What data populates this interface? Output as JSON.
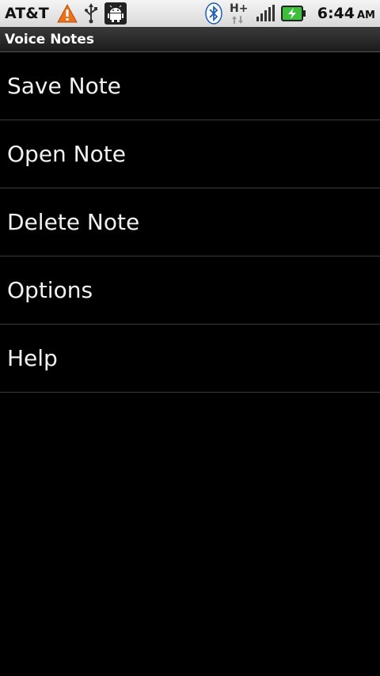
{
  "status_bar": {
    "carrier": "AT&T",
    "time": "6:44",
    "ampm": "AM",
    "network": "H+",
    "icons": [
      "warning-icon",
      "usb-icon",
      "android-debug-icon",
      "bluetooth-icon",
      "network-hplus-icon",
      "signal-icon",
      "battery-charging-icon"
    ],
    "colors": {
      "warning": "#e8731c",
      "battery": "#3cc03c"
    }
  },
  "title_bar": {
    "title": "Voice Notes"
  },
  "menu": {
    "items": [
      {
        "label": "Save Note"
      },
      {
        "label": "Open Note"
      },
      {
        "label": "Delete Note"
      },
      {
        "label": "Options"
      },
      {
        "label": "Help"
      }
    ]
  }
}
